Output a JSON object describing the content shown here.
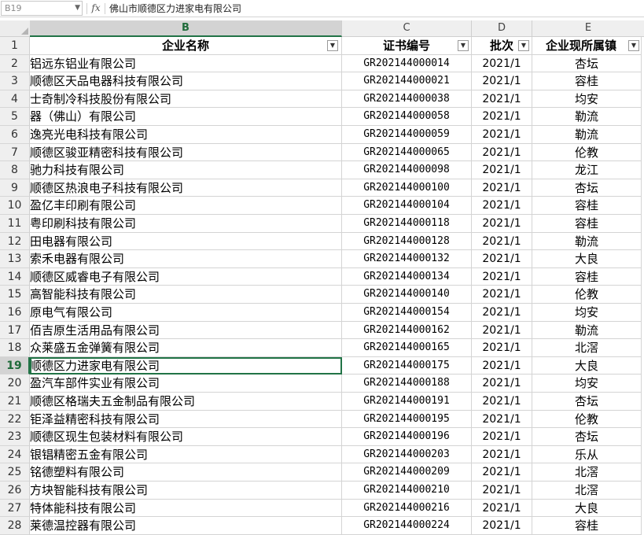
{
  "formula_bar": {
    "name_box": "B19",
    "fx": "fx",
    "formula": "佛山市顺德区力进家电有限公司"
  },
  "columns": [
    "B",
    "C",
    "D",
    "E"
  ],
  "selected_column": "B",
  "header": {
    "row_num": "1",
    "company": "企业名称",
    "cert": "证书编号",
    "batch": "批次",
    "town": "企业现所属镇"
  },
  "rows": [
    {
      "n": "2",
      "company": "铝远东铝业有限公司",
      "cert": "GR202144000014",
      "batch": "2021/1",
      "town": "杏坛"
    },
    {
      "n": "3",
      "company": "顺德区天品电器科技有限公司",
      "cert": "GR202144000021",
      "batch": "2021/1",
      "town": "容桂"
    },
    {
      "n": "4",
      "company": "士奇制冷科技股份有限公司",
      "cert": "GR202144000038",
      "batch": "2021/1",
      "town": "均安"
    },
    {
      "n": "5",
      "company": "器（佛山）有限公司",
      "cert": "GR202144000058",
      "batch": "2021/1",
      "town": "勒流"
    },
    {
      "n": "6",
      "company": "逸亮光电科技有限公司",
      "cert": "GR202144000059",
      "batch": "2021/1",
      "town": "勒流"
    },
    {
      "n": "7",
      "company": "顺德区骏亚精密科技有限公司",
      "cert": "GR202144000065",
      "batch": "2021/1",
      "town": "伦教"
    },
    {
      "n": "8",
      "company": "驰力科技有限公司",
      "cert": "GR202144000098",
      "batch": "2021/1",
      "town": "龙江"
    },
    {
      "n": "9",
      "company": "顺德区热浪电子科技有限公司",
      "cert": "GR202144000100",
      "batch": "2021/1",
      "town": "杏坛"
    },
    {
      "n": "10",
      "company": "盈亿丰印刷有限公司",
      "cert": "GR202144000104",
      "batch": "2021/1",
      "town": "容桂"
    },
    {
      "n": "11",
      "company": "粤印刷科技有限公司",
      "cert": "GR202144000118",
      "batch": "2021/1",
      "town": "容桂"
    },
    {
      "n": "12",
      "company": "田电器有限公司",
      "cert": "GR202144000128",
      "batch": "2021/1",
      "town": "勒流"
    },
    {
      "n": "13",
      "company": "索禾电器有限公司",
      "cert": "GR202144000132",
      "batch": "2021/1",
      "town": "大良"
    },
    {
      "n": "14",
      "company": "顺德区威睿电子有限公司",
      "cert": "GR202144000134",
      "batch": "2021/1",
      "town": "容桂"
    },
    {
      "n": "15",
      "company": "高智能科技有限公司",
      "cert": "GR202144000140",
      "batch": "2021/1",
      "town": "伦教"
    },
    {
      "n": "16",
      "company": "原电气有限公司",
      "cert": "GR202144000154",
      "batch": "2021/1",
      "town": "均安"
    },
    {
      "n": "17",
      "company": "佰吉原生活用品有限公司",
      "cert": "GR202144000162",
      "batch": "2021/1",
      "town": "勒流"
    },
    {
      "n": "18",
      "company": "众莱盛五金弹簧有限公司",
      "cert": "GR202144000165",
      "batch": "2021/1",
      "town": "北滘"
    },
    {
      "n": "19",
      "company": "顺德区力进家电有限公司",
      "cert": "GR202144000175",
      "batch": "2021/1",
      "town": "大良"
    },
    {
      "n": "20",
      "company": "盈汽车部件实业有限公司",
      "cert": "GR202144000188",
      "batch": "2021/1",
      "town": "均安"
    },
    {
      "n": "21",
      "company": "顺德区格瑞夫五金制品有限公司",
      "cert": "GR202144000191",
      "batch": "2021/1",
      "town": "杏坛"
    },
    {
      "n": "22",
      "company": "钜泽益精密科技有限公司",
      "cert": "GR202144000195",
      "batch": "2021/1",
      "town": "伦教"
    },
    {
      "n": "23",
      "company": "顺德区现生包装材料有限公司",
      "cert": "GR202144000196",
      "batch": "2021/1",
      "town": "杏坛"
    },
    {
      "n": "24",
      "company": "银锠精密五金有限公司",
      "cert": "GR202144000203",
      "batch": "2021/1",
      "town": "乐从"
    },
    {
      "n": "25",
      "company": "铭德塑料有限公司",
      "cert": "GR202144000209",
      "batch": "2021/1",
      "town": "北滘"
    },
    {
      "n": "26",
      "company": "方块智能科技有限公司",
      "cert": "GR202144000210",
      "batch": "2021/1",
      "town": "北滘"
    },
    {
      "n": "27",
      "company": "特体能科技有限公司",
      "cert": "GR202144000216",
      "batch": "2021/1",
      "town": "大良"
    },
    {
      "n": "28",
      "company": "莱德温控器有限公司",
      "cert": "GR202144000224",
      "batch": "2021/1",
      "town": "容桂"
    }
  ],
  "active_row": "19"
}
